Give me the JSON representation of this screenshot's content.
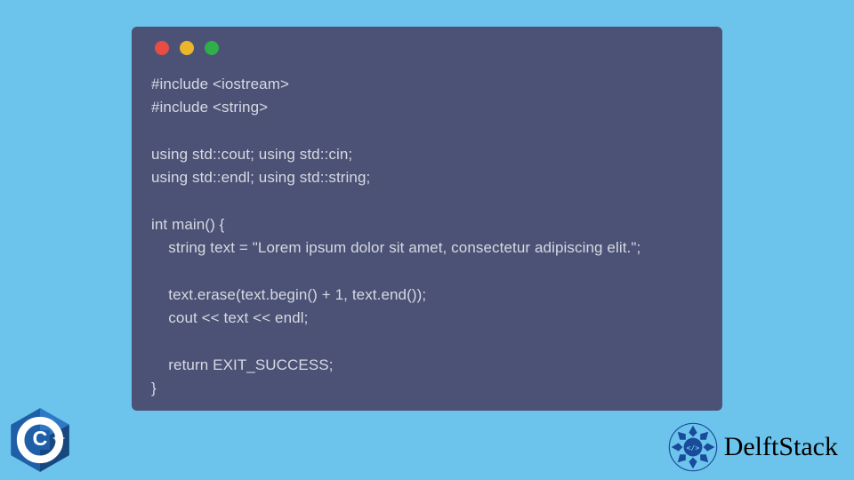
{
  "window": {
    "dots": [
      "red",
      "yellow",
      "green"
    ]
  },
  "code": {
    "content": "#include <iostream>\n#include <string>\n\nusing std::cout; using std::cin;\nusing std::endl; using std::string;\n\nint main() {\n    string text = \"Lorem ipsum dolor sit amet, consectetur adipiscing elit.\";\n\n    text.erase(text.begin() + 1, text.end());\n    cout << text << endl;\n\n    return EXIT_SUCCESS;\n}"
  },
  "badges": {
    "cpp_label": "C++",
    "brand_name": "DelftStack"
  },
  "colors": {
    "background": "#6cc4ec",
    "code_bg": "#4b5275",
    "code_text": "#d7d9e2",
    "dot_red": "#e84d45",
    "dot_yellow": "#ecb62a",
    "dot_green": "#2fae4a",
    "cpp_blue": "#1f5fa8",
    "brand_blue": "#1a3a7a"
  }
}
